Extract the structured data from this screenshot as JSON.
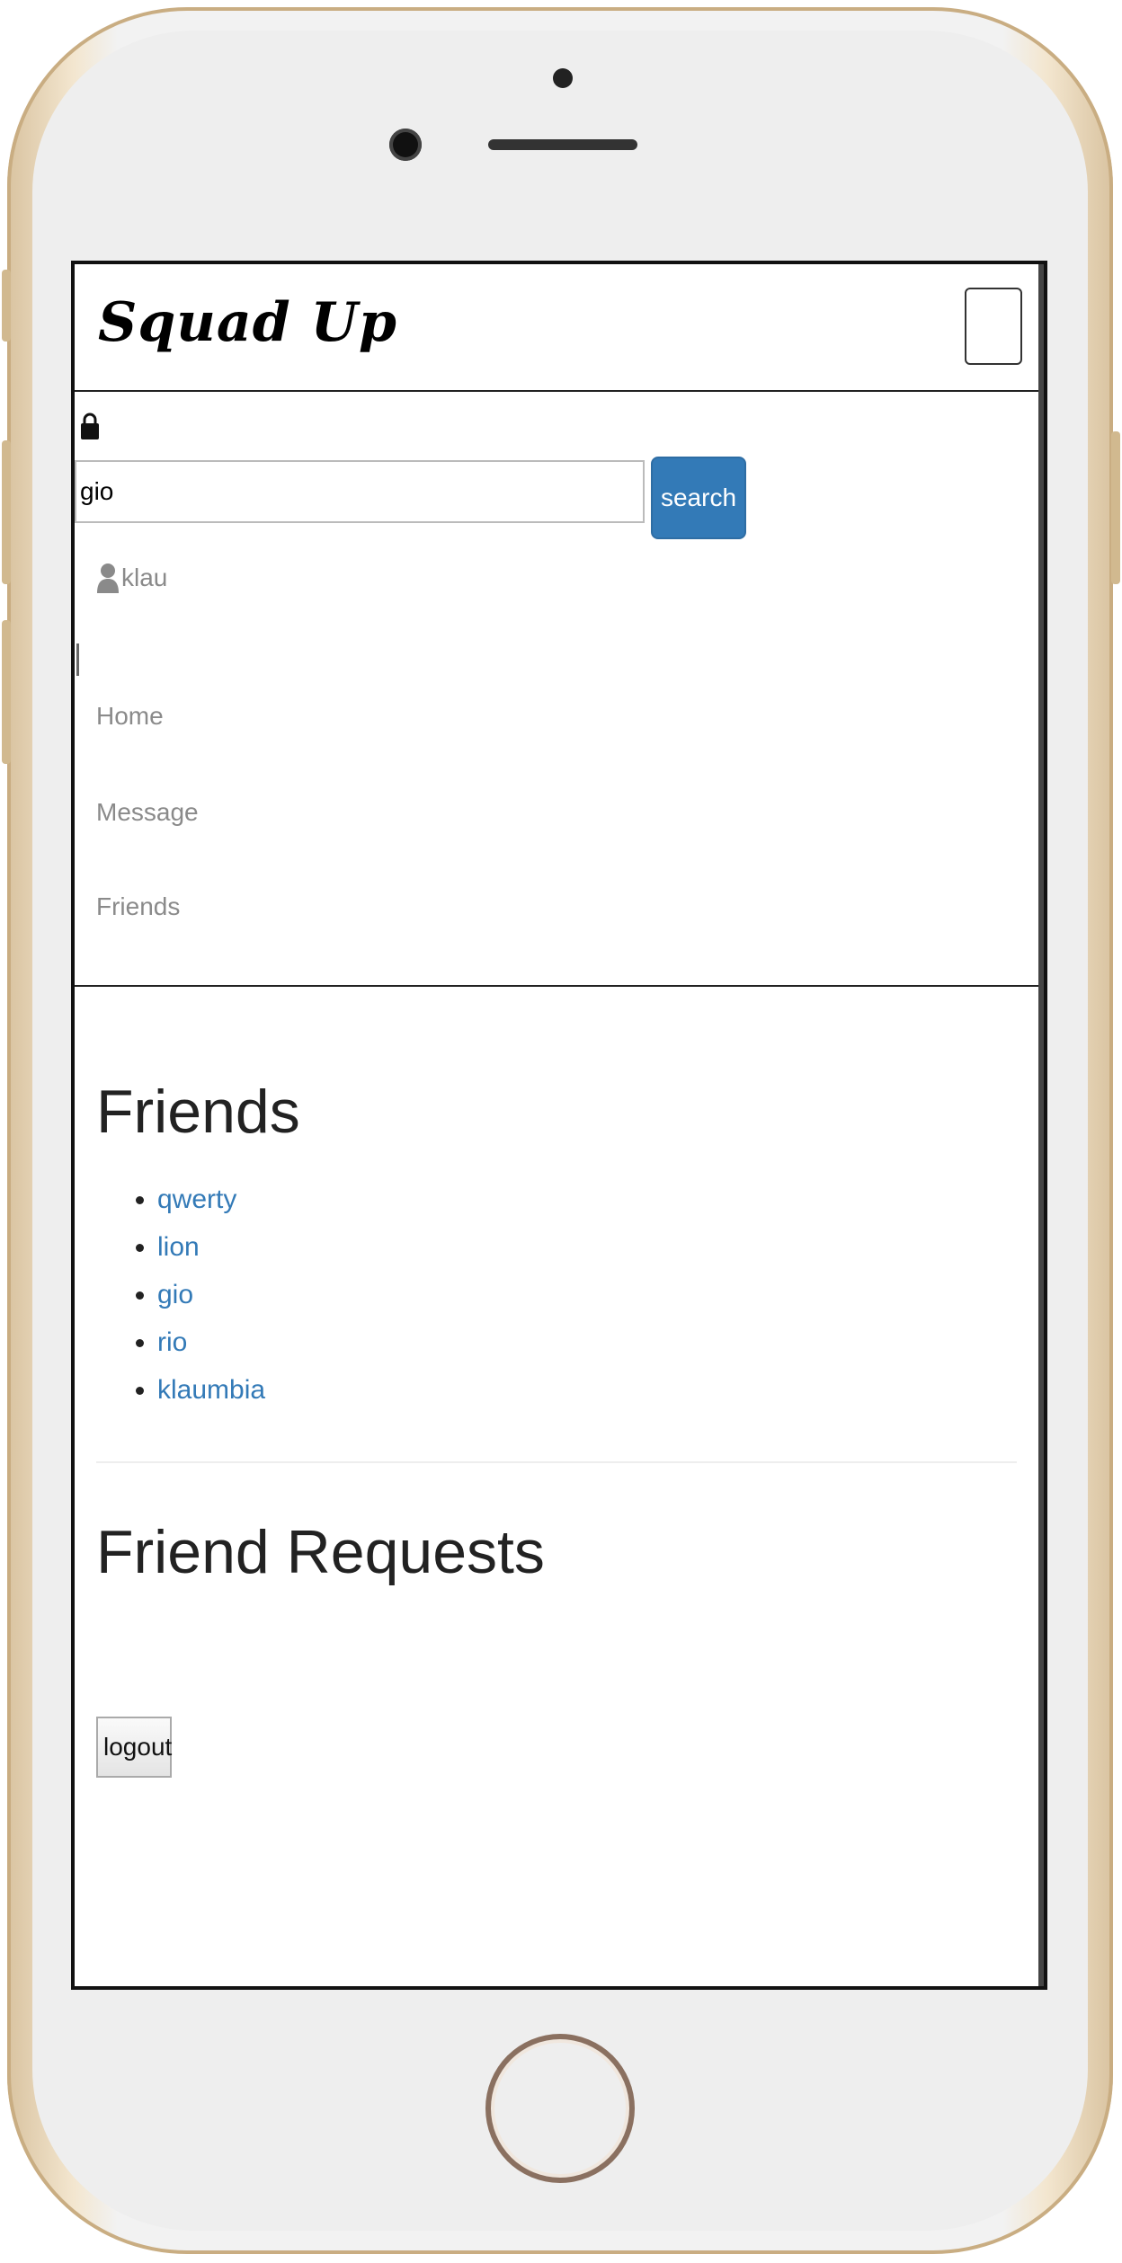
{
  "app": {
    "brand": "Squad Up"
  },
  "search": {
    "value": "gio",
    "button_label": "search"
  },
  "user": {
    "name": "klau"
  },
  "nav": {
    "items": [
      "Home",
      "Message",
      "Friends"
    ]
  },
  "friends": {
    "heading": "Friends",
    "list": [
      "qwerty",
      "lion",
      "gio",
      "rio",
      "klaumbia"
    ]
  },
  "requests": {
    "heading": "Friend Requests"
  },
  "actions": {
    "logout_label": "logout"
  },
  "icons": [
    "lock-icon",
    "user-icon",
    "menu-toggle"
  ],
  "colors": {
    "link": "#337ab7",
    "primary_button": "#337ab7",
    "nav_text": "#8a8a8a"
  }
}
